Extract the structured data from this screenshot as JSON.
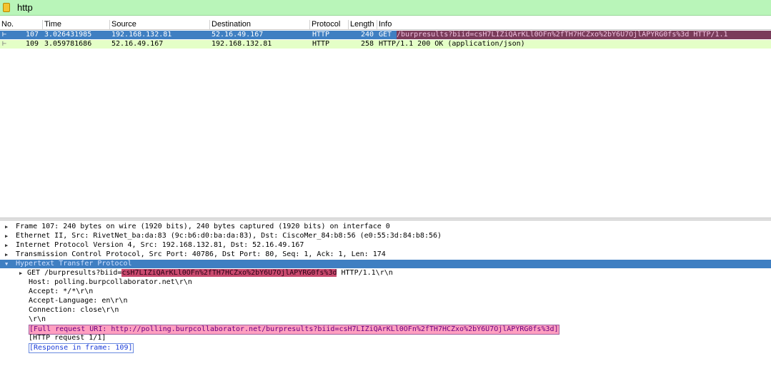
{
  "filter": {
    "value": "http"
  },
  "columns": {
    "no": "No.",
    "time": "Time",
    "source": "Source",
    "destination": "Destination",
    "protocol": "Protocol",
    "length": "Length",
    "info": "Info"
  },
  "packets": [
    {
      "no": "107",
      "time": "3.026431985",
      "source": "192.168.132.81",
      "destination": "52.16.49.167",
      "protocol": "HTTP",
      "length": "240",
      "info_method": "GET",
      "info_rest": "/burpresults?biid=csH7LIZiQArKLl0OFn%2fTH7HCZxo%2bY6U7OjlAPYRG0fs%3d HTTP/1.1"
    },
    {
      "no": "109",
      "time": "3.059781686",
      "source": "52.16.49.167",
      "destination": "192.168.132.81",
      "protocol": "HTTP",
      "length": "258",
      "info": "HTTP/1.1 200 OK  (application/json)"
    }
  ],
  "details": {
    "frame": "Frame 107: 240 bytes on wire (1920 bits), 240 bytes captured (1920 bits) on interface 0",
    "ethernet": "Ethernet II, Src: RivetNet_ba:da:83 (9c:b6:d0:ba:da:83), Dst: CiscoMer_84:b8:56 (e0:55:3d:84:b8:56)",
    "ip": "Internet Protocol Version 4, Src: 192.168.132.81, Dst: 52.16.49.167",
    "tcp": "Transmission Control Protocol, Src Port: 40786, Dst Port: 80, Seq: 1, Ack: 1, Len: 174",
    "http": "Hypertext Transfer Protocol",
    "get_prefix": "GET /burpresults?biid=",
    "get_biid": "csH7LIZiQArKLl0OFn%2fTH7HCZxo%2bY6U7OjlAPYRG0fs%3d",
    "get_suffix": " HTTP/1.1\\r\\n",
    "host": "Host: polling.burpcollaborator.net\\r\\n",
    "accept": "Accept: */*\\r\\n",
    "accept_language": "Accept-Language: en\\r\\n",
    "connection": "Connection: close\\r\\n",
    "crlf": "\\r\\n",
    "full_uri": "[Full request URI: http://polling.burpcollaborator.net/burpresults?biid=csH7LIZiQArKLl0OFn%2fTH7HCZxo%2bY6U7OjlAPYRG0fs%3d]",
    "request_count": "[HTTP request 1/1]",
    "response_in": "[Response in frame: 109]"
  },
  "icons": {
    "expand": "triangle-right",
    "collapse": "triangle-down",
    "filter": "bookmark"
  },
  "colors": {
    "selected_row": "#3f7fc2",
    "response_row": "#e4ffc7",
    "filter_bg": "#b9f5b9"
  }
}
